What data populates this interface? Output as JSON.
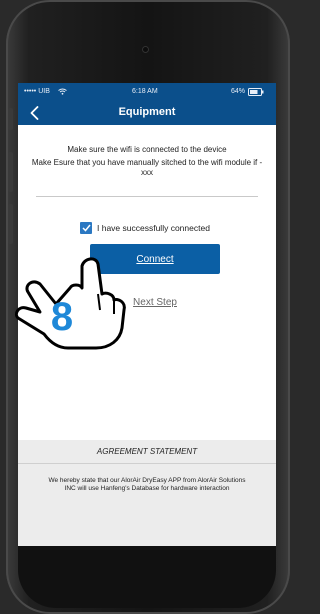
{
  "status_bar": {
    "carrier": "••••• UIB",
    "time": "6:18 AM",
    "battery": "64%"
  },
  "nav": {
    "title": "Equipment",
    "back_icon": "chevron-left-icon"
  },
  "instructions": {
    "line1": "Make sure the wifi is connected to the device",
    "line2": "Make Esure that you have manually sitched to the wifi module if - xxx"
  },
  "checkbox": {
    "label": "I have successfully connected",
    "checked": true
  },
  "buttons": {
    "connect": "Connect",
    "next_step": "Next Step"
  },
  "overlay": {
    "step_number": "8",
    "icon": "hand-pointer-icon"
  },
  "agreement": {
    "title": "AGREEMENT STATEMENT",
    "text": "We hereby state that our AlorAir DryEasy APP from AlorAir Solutions INC will use Hanfeng's Database for hardware interaction"
  },
  "colors": {
    "nav_bg": "#0b4f8b",
    "button_bg": "#0b5fa5",
    "checkbox": "#2b78c2",
    "step_number": "#1e88d8"
  }
}
